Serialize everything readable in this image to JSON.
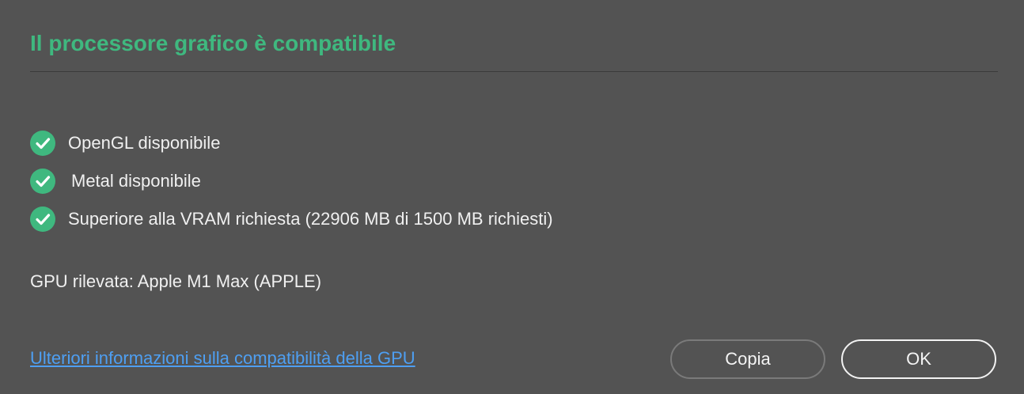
{
  "dialog": {
    "title": "Il processore grafico è compatibile",
    "checks": [
      {
        "label": "OpenGL disponibile",
        "icon": "check-circle-icon"
      },
      {
        "label": "Metal disponibile",
        "icon": "check-circle-icon"
      },
      {
        "label": "Superiore alla VRAM richiesta (22906 MB di 1500 MB richiesti)",
        "icon": "check-circle-icon"
      }
    ],
    "gpu_detected": "GPU rilevata: Apple M1 Max (APPLE)",
    "info_link": "Ulteriori informazioni sulla compatibilità della GPU",
    "copy_label": "Copia",
    "ok_label": "OK"
  },
  "colors": {
    "background": "#535353",
    "accent_green": "#3fb87f",
    "link_blue": "#4e9ff2",
    "text": "#f0f0f0"
  }
}
